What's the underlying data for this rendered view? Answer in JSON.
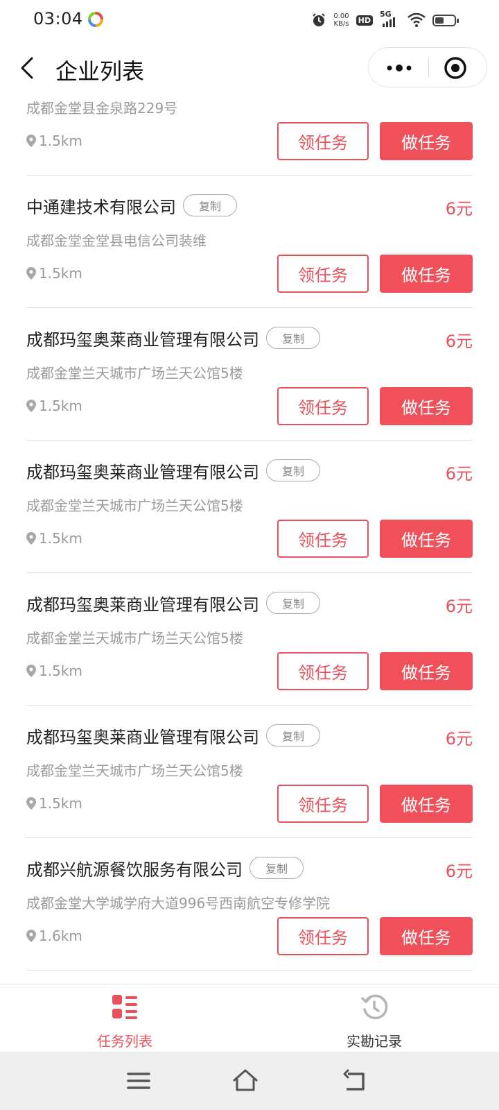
{
  "status_bar": {
    "time": "03:04",
    "net_speed_value": "0.00",
    "net_speed_unit": "KB/s",
    "hd": "HD",
    "network": "5G",
    "battery_level": 0.45
  },
  "nav": {
    "title": "企业列表"
  },
  "items": [
    {
      "name": "",
      "copy_label": "",
      "price": "",
      "address": "成都金堂县金泉路229号",
      "distance": "1.5km",
      "claim_label": "领任务",
      "do_label": "做任务"
    },
    {
      "name": "中通建技术有限公司",
      "copy_label": "复制",
      "price": "6元",
      "address": "成都金堂金堂县电信公司装维",
      "distance": "1.5km",
      "claim_label": "领任务",
      "do_label": "做任务"
    },
    {
      "name": "成都玛玺奥莱商业管理有限公司",
      "copy_label": "复制",
      "price": "6元",
      "address": "成都金堂兰天城市广场兰天公馆5楼",
      "distance": "1.5km",
      "claim_label": "领任务",
      "do_label": "做任务"
    },
    {
      "name": "成都玛玺奥莱商业管理有限公司",
      "copy_label": "复制",
      "price": "6元",
      "address": "成都金堂兰天城市广场兰天公馆5楼",
      "distance": "1.5km",
      "claim_label": "领任务",
      "do_label": "做任务"
    },
    {
      "name": "成都玛玺奥莱商业管理有限公司",
      "copy_label": "复制",
      "price": "6元",
      "address": "成都金堂兰天城市广场兰天公馆5楼",
      "distance": "1.5km",
      "claim_label": "领任务",
      "do_label": "做任务"
    },
    {
      "name": "成都玛玺奥莱商业管理有限公司",
      "copy_label": "复制",
      "price": "6元",
      "address": "成都金堂兰天城市广场兰天公馆5楼",
      "distance": "1.5km",
      "claim_label": "领任务",
      "do_label": "做任务"
    },
    {
      "name": "成都兴航源餐饮服务有限公司",
      "copy_label": "复制",
      "price": "6元",
      "address": "成都金堂大学城学府大道996号西南航空专修学院",
      "distance": "1.6km",
      "claim_label": "领任务",
      "do_label": "做任务"
    }
  ],
  "tabbar": {
    "tabs": [
      {
        "label": "任务列表",
        "icon": "task-list-icon",
        "active": true
      },
      {
        "label": "实勘记录",
        "icon": "history-clock-icon",
        "active": false
      }
    ]
  },
  "colors": {
    "accent": "#f0505a",
    "accent_text": "#e8505b",
    "muted_text": "#9a9a9a"
  }
}
